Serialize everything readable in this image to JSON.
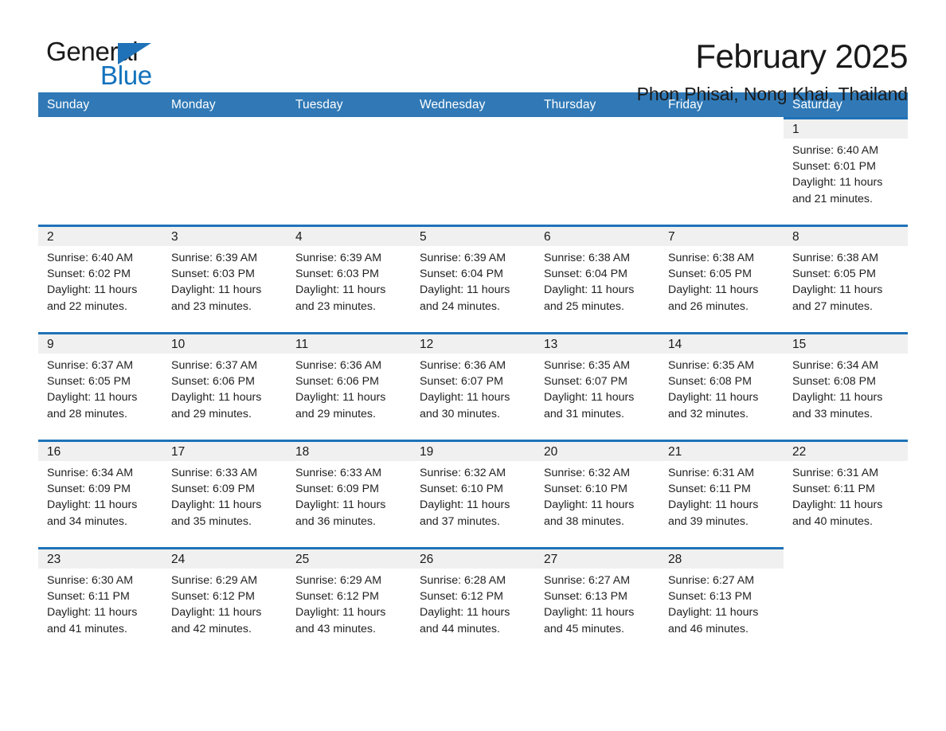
{
  "brand": {
    "name_part1": "General",
    "name_part2": "Blue",
    "triangle_color": "#1f72b8",
    "blue_color": "#1272bd"
  },
  "header": {
    "month_title": "February 2025",
    "location": "Phon Phisai, Nong Khai, Thailand"
  },
  "calendar": {
    "header_bg": "#3079b6",
    "row_accent": "#1f72b8",
    "daynum_band_bg": "#f0f0f0",
    "weekdays": [
      "Sunday",
      "Monday",
      "Tuesday",
      "Wednesday",
      "Thursday",
      "Friday",
      "Saturday"
    ],
    "weeks": [
      [
        {
          "blank": true
        },
        {
          "blank": true
        },
        {
          "blank": true
        },
        {
          "blank": true
        },
        {
          "blank": true
        },
        {
          "blank": true
        },
        {
          "day": "1",
          "sunrise": "Sunrise: 6:40 AM",
          "sunset": "Sunset: 6:01 PM",
          "daylight_1": "Daylight: 11 hours",
          "daylight_2": "and 21 minutes."
        }
      ],
      [
        {
          "day": "2",
          "sunrise": "Sunrise: 6:40 AM",
          "sunset": "Sunset: 6:02 PM",
          "daylight_1": "Daylight: 11 hours",
          "daylight_2": "and 22 minutes."
        },
        {
          "day": "3",
          "sunrise": "Sunrise: 6:39 AM",
          "sunset": "Sunset: 6:03 PM",
          "daylight_1": "Daylight: 11 hours",
          "daylight_2": "and 23 minutes."
        },
        {
          "day": "4",
          "sunrise": "Sunrise: 6:39 AM",
          "sunset": "Sunset: 6:03 PM",
          "daylight_1": "Daylight: 11 hours",
          "daylight_2": "and 23 minutes."
        },
        {
          "day": "5",
          "sunrise": "Sunrise: 6:39 AM",
          "sunset": "Sunset: 6:04 PM",
          "daylight_1": "Daylight: 11 hours",
          "daylight_2": "and 24 minutes."
        },
        {
          "day": "6",
          "sunrise": "Sunrise: 6:38 AM",
          "sunset": "Sunset: 6:04 PM",
          "daylight_1": "Daylight: 11 hours",
          "daylight_2": "and 25 minutes."
        },
        {
          "day": "7",
          "sunrise": "Sunrise: 6:38 AM",
          "sunset": "Sunset: 6:05 PM",
          "daylight_1": "Daylight: 11 hours",
          "daylight_2": "and 26 minutes."
        },
        {
          "day": "8",
          "sunrise": "Sunrise: 6:38 AM",
          "sunset": "Sunset: 6:05 PM",
          "daylight_1": "Daylight: 11 hours",
          "daylight_2": "and 27 minutes."
        }
      ],
      [
        {
          "day": "9",
          "sunrise": "Sunrise: 6:37 AM",
          "sunset": "Sunset: 6:05 PM",
          "daylight_1": "Daylight: 11 hours",
          "daylight_2": "and 28 minutes."
        },
        {
          "day": "10",
          "sunrise": "Sunrise: 6:37 AM",
          "sunset": "Sunset: 6:06 PM",
          "daylight_1": "Daylight: 11 hours",
          "daylight_2": "and 29 minutes."
        },
        {
          "day": "11",
          "sunrise": "Sunrise: 6:36 AM",
          "sunset": "Sunset: 6:06 PM",
          "daylight_1": "Daylight: 11 hours",
          "daylight_2": "and 29 minutes."
        },
        {
          "day": "12",
          "sunrise": "Sunrise: 6:36 AM",
          "sunset": "Sunset: 6:07 PM",
          "daylight_1": "Daylight: 11 hours",
          "daylight_2": "and 30 minutes."
        },
        {
          "day": "13",
          "sunrise": "Sunrise: 6:35 AM",
          "sunset": "Sunset: 6:07 PM",
          "daylight_1": "Daylight: 11 hours",
          "daylight_2": "and 31 minutes."
        },
        {
          "day": "14",
          "sunrise": "Sunrise: 6:35 AM",
          "sunset": "Sunset: 6:08 PM",
          "daylight_1": "Daylight: 11 hours",
          "daylight_2": "and 32 minutes."
        },
        {
          "day": "15",
          "sunrise": "Sunrise: 6:34 AM",
          "sunset": "Sunset: 6:08 PM",
          "daylight_1": "Daylight: 11 hours",
          "daylight_2": "and 33 minutes."
        }
      ],
      [
        {
          "day": "16",
          "sunrise": "Sunrise: 6:34 AM",
          "sunset": "Sunset: 6:09 PM",
          "daylight_1": "Daylight: 11 hours",
          "daylight_2": "and 34 minutes."
        },
        {
          "day": "17",
          "sunrise": "Sunrise: 6:33 AM",
          "sunset": "Sunset: 6:09 PM",
          "daylight_1": "Daylight: 11 hours",
          "daylight_2": "and 35 minutes."
        },
        {
          "day": "18",
          "sunrise": "Sunrise: 6:33 AM",
          "sunset": "Sunset: 6:09 PM",
          "daylight_1": "Daylight: 11 hours",
          "daylight_2": "and 36 minutes."
        },
        {
          "day": "19",
          "sunrise": "Sunrise: 6:32 AM",
          "sunset": "Sunset: 6:10 PM",
          "daylight_1": "Daylight: 11 hours",
          "daylight_2": "and 37 minutes."
        },
        {
          "day": "20",
          "sunrise": "Sunrise: 6:32 AM",
          "sunset": "Sunset: 6:10 PM",
          "daylight_1": "Daylight: 11 hours",
          "daylight_2": "and 38 minutes."
        },
        {
          "day": "21",
          "sunrise": "Sunrise: 6:31 AM",
          "sunset": "Sunset: 6:11 PM",
          "daylight_1": "Daylight: 11 hours",
          "daylight_2": "and 39 minutes."
        },
        {
          "day": "22",
          "sunrise": "Sunrise: 6:31 AM",
          "sunset": "Sunset: 6:11 PM",
          "daylight_1": "Daylight: 11 hours",
          "daylight_2": "and 40 minutes."
        }
      ],
      [
        {
          "day": "23",
          "sunrise": "Sunrise: 6:30 AM",
          "sunset": "Sunset: 6:11 PM",
          "daylight_1": "Daylight: 11 hours",
          "daylight_2": "and 41 minutes."
        },
        {
          "day": "24",
          "sunrise": "Sunrise: 6:29 AM",
          "sunset": "Sunset: 6:12 PM",
          "daylight_1": "Daylight: 11 hours",
          "daylight_2": "and 42 minutes."
        },
        {
          "day": "25",
          "sunrise": "Sunrise: 6:29 AM",
          "sunset": "Sunset: 6:12 PM",
          "daylight_1": "Daylight: 11 hours",
          "daylight_2": "and 43 minutes."
        },
        {
          "day": "26",
          "sunrise": "Sunrise: 6:28 AM",
          "sunset": "Sunset: 6:12 PM",
          "daylight_1": "Daylight: 11 hours",
          "daylight_2": "and 44 minutes."
        },
        {
          "day": "27",
          "sunrise": "Sunrise: 6:27 AM",
          "sunset": "Sunset: 6:13 PM",
          "daylight_1": "Daylight: 11 hours",
          "daylight_2": "and 45 minutes."
        },
        {
          "day": "28",
          "sunrise": "Sunrise: 6:27 AM",
          "sunset": "Sunset: 6:13 PM",
          "daylight_1": "Daylight: 11 hours",
          "daylight_2": "and 46 minutes."
        },
        {
          "blank": true
        }
      ]
    ]
  }
}
